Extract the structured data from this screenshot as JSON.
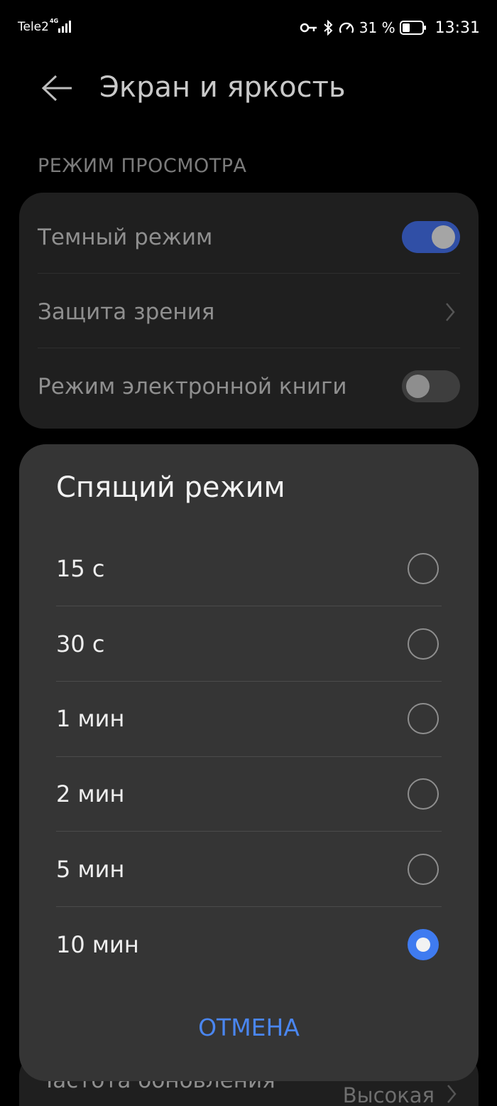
{
  "status_bar": {
    "carrier": "Tele2",
    "network_type": "4G",
    "battery_percent": "31 %",
    "time": "13:31",
    "icons": [
      "key-icon",
      "bluetooth-icon",
      "speedometer-icon",
      "battery-icon"
    ]
  },
  "header": {
    "title": "Экран и яркость",
    "back_icon": "back-arrow-icon"
  },
  "sections": {
    "view_mode": {
      "header": "РЕЖИМ ПРОСМОТРА",
      "rows": [
        {
          "label": "Темный режим",
          "control": "toggle",
          "on": true
        },
        {
          "label": "Защита зрения",
          "control": "chevron"
        },
        {
          "label": "Режим электронной книги",
          "control": "toggle",
          "on": false
        }
      ]
    },
    "refresh": {
      "label": "Частота обновления",
      "value": "Высокая"
    }
  },
  "dialog": {
    "title": "Спящий режим",
    "options": [
      {
        "label": "15 с",
        "selected": false
      },
      {
        "label": "30 с",
        "selected": false
      },
      {
        "label": "1 мин",
        "selected": false
      },
      {
        "label": "2 мин",
        "selected": false
      },
      {
        "label": "5 мин",
        "selected": false
      },
      {
        "label": "10 мин",
        "selected": true
      }
    ],
    "cancel_label": "ОТМЕНА"
  },
  "colors": {
    "accent": "#3f7bf0",
    "toggle_on": "#304fa6",
    "dialog_bg": "#353535",
    "card_bg": "#1f1f1f"
  }
}
